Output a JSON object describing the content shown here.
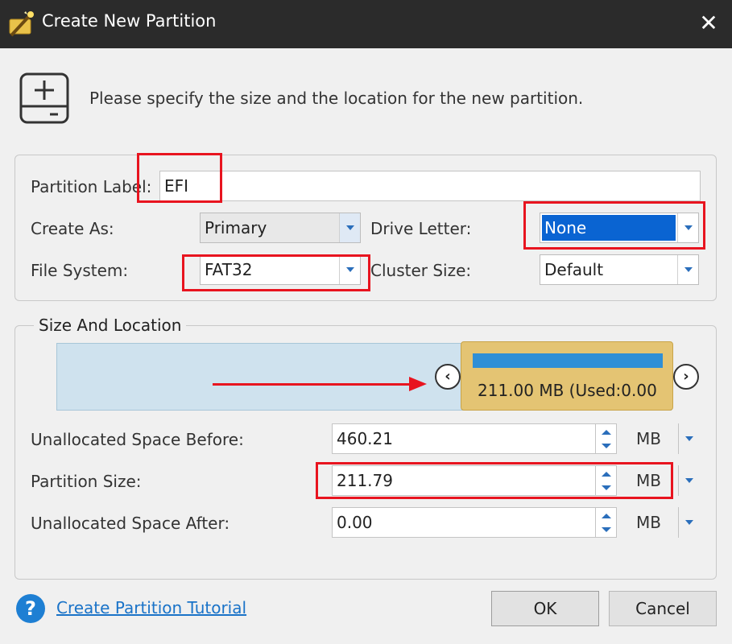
{
  "window": {
    "title": "Create New Partition",
    "close_glyph": "✕"
  },
  "header": {
    "instruction": "Please specify the size and the location for the new partition."
  },
  "form": {
    "partition_label": {
      "label": "Partition Label:",
      "value": "EFI"
    },
    "create_as": {
      "label": "Create As:",
      "value": "Primary"
    },
    "drive_letter": {
      "label": "Drive Letter:",
      "value": "None"
    },
    "file_system": {
      "label": "File System:",
      "value": "FAT32"
    },
    "cluster_size": {
      "label": "Cluster Size:",
      "value": "Default"
    }
  },
  "size_location": {
    "legend": "Size And Location",
    "partition_block_text": "211.00 MB (Used:0.00",
    "prev_glyph": "‹",
    "next_glyph": "›",
    "unallocated_before": {
      "label": "Unallocated Space Before:",
      "value": "460.21",
      "unit": "MB"
    },
    "partition_size": {
      "label": "Partition Size:",
      "value": "211.79",
      "unit": "MB"
    },
    "unallocated_after": {
      "label": "Unallocated Space After:",
      "value": "0.00",
      "unit": "MB"
    }
  },
  "footer": {
    "help_glyph": "?",
    "tutorial_link": "Create Partition Tutorial",
    "ok_label": "OK",
    "cancel_label": "Cancel"
  },
  "colors": {
    "highlight_red": "#e8141f",
    "selection_blue": "#0a64d2",
    "partition_gold": "#e4c473",
    "partition_fill": "#2f8fd6",
    "link_blue": "#1a73c8"
  },
  "icons": [
    "app-wand-icon",
    "close-icon",
    "disk-add-icon",
    "help-icon",
    "chevron-left-icon",
    "chevron-right-icon",
    "dropdown-arrow-icon",
    "spin-arrows-icon"
  ]
}
